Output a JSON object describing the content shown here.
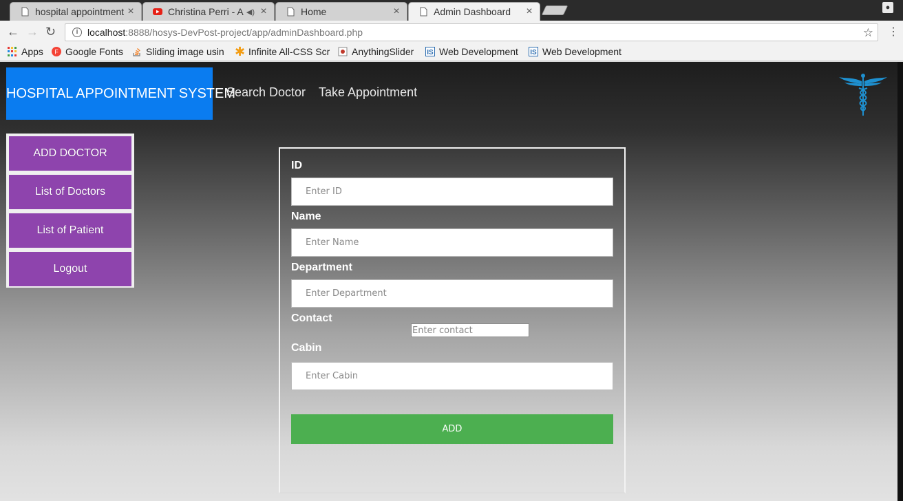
{
  "browser": {
    "tabs": [
      {
        "title": "hospital appointment"
      },
      {
        "title": "Christina Perri - A"
      },
      {
        "title": "Home"
      },
      {
        "title": "Admin Dashboard"
      }
    ],
    "url_host": "localhost",
    "url_path": ":8888/hosys-DevPost-project/app/adminDashboard.php",
    "bookmarks": [
      {
        "label": "Apps"
      },
      {
        "label": "Google Fonts"
      },
      {
        "label": "Sliding image usin"
      },
      {
        "label": "Infinite All-CSS Scr"
      },
      {
        "label": "AnythingSlider"
      },
      {
        "label": "Web Development"
      },
      {
        "label": "Web Development"
      }
    ]
  },
  "site": {
    "brand": "HOSPITAL APPOINTMENT SYSTEM",
    "nav": [
      "Search Doctor",
      "Take Appointment"
    ],
    "brand_color": "#0a7cf0"
  },
  "sidebar": {
    "items": [
      "ADD DOCTOR",
      "List of Doctors",
      "List of Patient",
      "Logout"
    ],
    "color": "#8e44ad"
  },
  "form": {
    "fields": [
      {
        "label": "ID",
        "placeholder": "Enter ID"
      },
      {
        "label": "Name",
        "placeholder": "Enter Name"
      },
      {
        "label": "Department",
        "placeholder": "Enter Department"
      },
      {
        "label": "Contact",
        "placeholder": "Enter contact"
      },
      {
        "label": "Cabin",
        "placeholder": "Enter Cabin"
      }
    ],
    "submit_label": "ADD",
    "submit_color": "#4caf50"
  }
}
